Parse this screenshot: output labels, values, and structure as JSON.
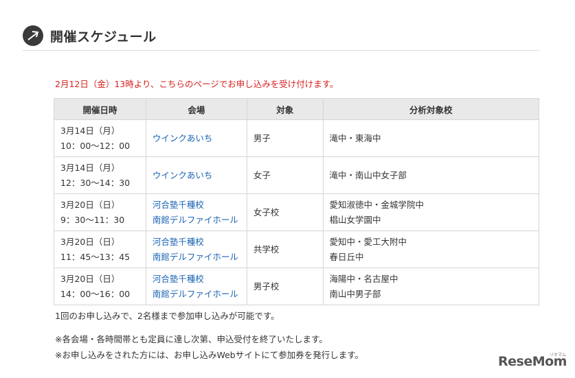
{
  "section": {
    "title": "開催スケジュール",
    "icon": "arrow-circle-icon"
  },
  "notice": "2月12日（金）13時より、こちらのページでお申し込みを受け付けます。",
  "table": {
    "headers": [
      "開催日時",
      "会場",
      "対象",
      "分析対象校"
    ],
    "rows": [
      {
        "date": "3月14日（月）",
        "time": "10：00〜12：00",
        "venue": [
          "ウインクあいち"
        ],
        "target": "男子",
        "schools": [
          "滝中・東海中"
        ]
      },
      {
        "date": "3月14日（月）",
        "time": "12：30〜14：30",
        "venue": [
          "ウインクあいち"
        ],
        "target": "女子",
        "schools": [
          "滝中・南山中女子部"
        ]
      },
      {
        "date": "3月20日（日）",
        "time": "9：30〜11：30",
        "venue": [
          "河合塾千種校",
          "南館デルファイホール"
        ],
        "target": "女子校",
        "schools": [
          "愛知淑徳中・金城学院中",
          "椙山女学園中"
        ]
      },
      {
        "date": "3月20日（日）",
        "time": "11：45〜13：45",
        "venue": [
          "河合塾千種校",
          "南館デルファイホール"
        ],
        "target": "共学校",
        "schools": [
          "愛知中・愛工大附中",
          "春日丘中"
        ]
      },
      {
        "date": "3月20日（日）",
        "time": "14：00〜16：00",
        "venue": [
          "河合塾千種校",
          "南館デルファイホール"
        ],
        "target": "男子校",
        "schools": [
          "海陽中・名古屋中",
          "南山中男子部"
        ]
      }
    ]
  },
  "notes": [
    "1回のお申し込みで、2名様まで参加申し込みが可能です。",
    "※各会場・各時間帯とも定員に達し次第、申込受付を終了いたします。",
    "※お申し込みをされた方には、お申し込みWebサイトにて参加券を発行します。"
  ],
  "watermark": {
    "brand": "ReseMom",
    "sub": "リセマム"
  },
  "colors": {
    "notice": "#d62020",
    "link": "#1a63b3",
    "header_bg": "#e9e9e9"
  }
}
